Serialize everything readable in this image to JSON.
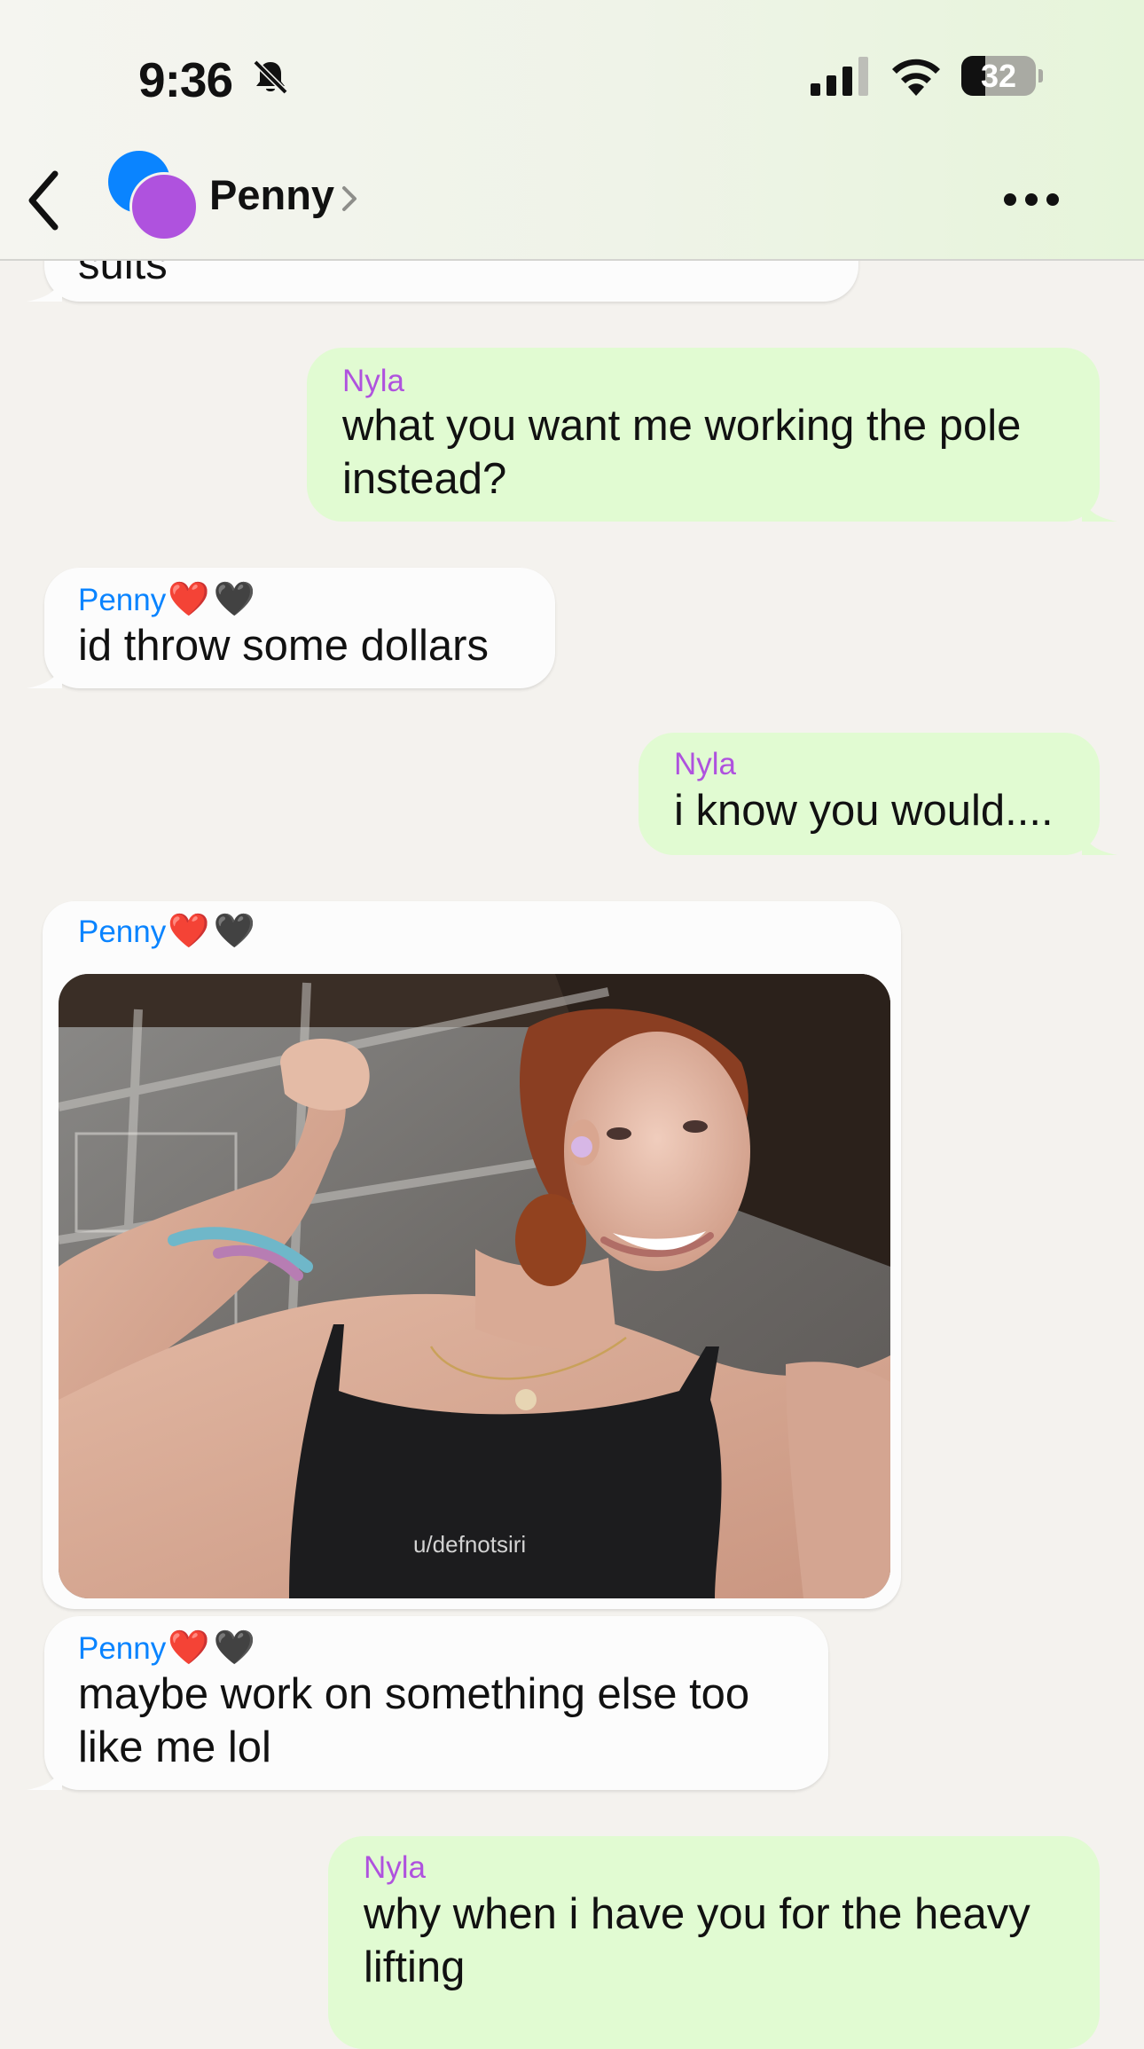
{
  "status_bar": {
    "time": "9:36",
    "battery_level": "32",
    "battery_fraction": 0.32
  },
  "nav": {
    "contact_name": "Penny",
    "icons": [
      "back-chevron-icon",
      "chevron-right-icon",
      "more-icon",
      "bell-slash-icon"
    ]
  },
  "colors": {
    "incoming_bubble": "#FCFCFC",
    "outgoing_bubble": "#E1FBD2",
    "penny_name": "#0A84FF",
    "nyla_name": "#AF52DE",
    "background": "#F4F2EE"
  },
  "messages": [
    {
      "from": "Penny",
      "text": "suits"
    },
    {
      "from": "Nyla",
      "sender": "Nyla",
      "text": "what you want me working the pole\ninstead?"
    },
    {
      "from": "Penny",
      "sender": "Penny",
      "hearts": "❤️🖤",
      "text": "id throw some dollars"
    },
    {
      "from": "Nyla",
      "sender": "Nyla",
      "text": "i know you would...."
    },
    {
      "from": "Penny",
      "sender": "Penny",
      "hearts": "❤️🖤",
      "photo_watermark": "u/defnotsiri"
    },
    {
      "from": "Penny",
      "sender": "Penny",
      "hearts": "❤️🖤",
      "text": "maybe work on something else too\nlike me lol"
    },
    {
      "from": "Nyla",
      "sender": "Nyla",
      "text": "why when i have you for the heavy\nlifting"
    }
  ]
}
